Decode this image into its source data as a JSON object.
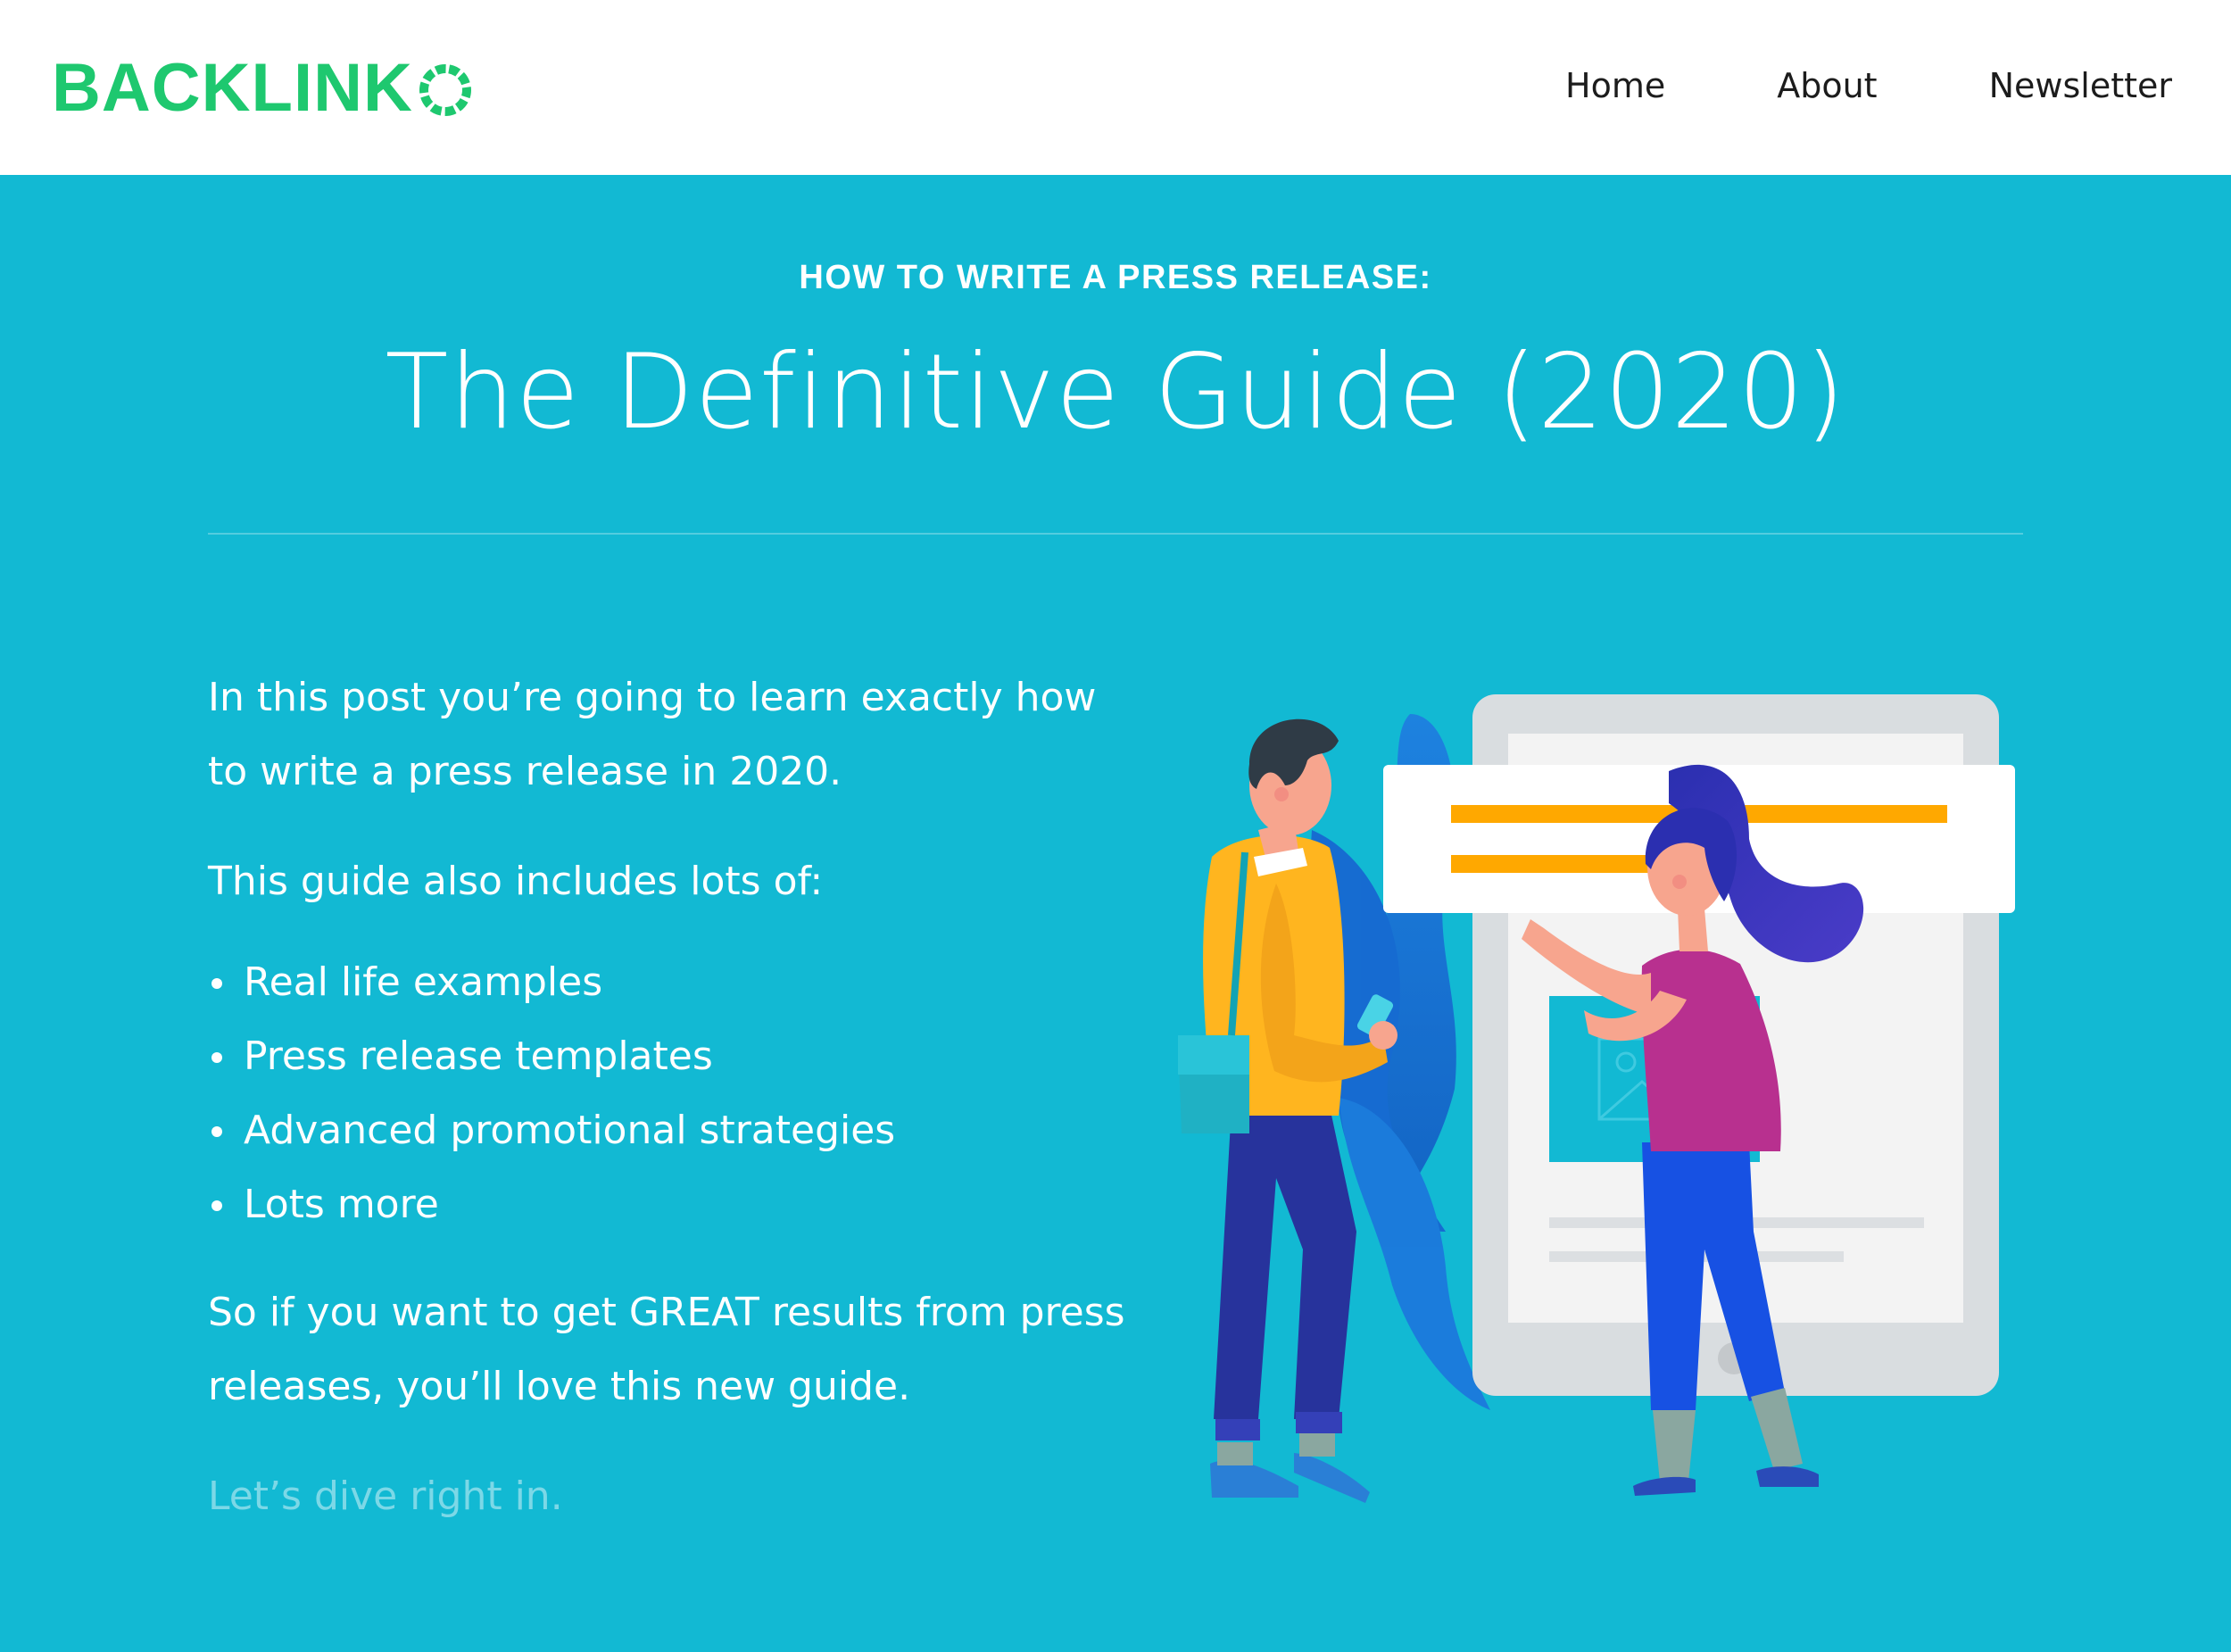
{
  "brand": {
    "name": "BACKLINKO",
    "text": "BACKLINK",
    "accent_color": "#1ec86f"
  },
  "nav": {
    "items": [
      {
        "label": "Home"
      },
      {
        "label": "About"
      },
      {
        "label": "Newsletter"
      }
    ]
  },
  "hero": {
    "kicker": "HOW TO WRITE A PRESS RELEASE:",
    "title": "The Definitive Guide (2020)",
    "background_color": "#12b9d3"
  },
  "intro": {
    "paragraph_1": "In this post you’re going to learn exactly how to write a press release in 2020.",
    "paragraph_2": "This guide also includes lots of:",
    "list": [
      "Real life examples",
      "Press release templates",
      "Advanced promotional strategies",
      "Lots more"
    ],
    "paragraph_3": "So if you want to get GREAT results from press releases, you’ll love this new guide.",
    "paragraph_4": "Let’s dive right in."
  },
  "illustration": {
    "icon": "people-with-tablet-illustration",
    "colors": {
      "tablet": "#e3e6e8",
      "card_bars": "#ffa800",
      "man_sweater": "#ffb51f",
      "woman_shirt": "#b8308f",
      "pants": "#27339c",
      "plant": "#1a73d9"
    }
  }
}
